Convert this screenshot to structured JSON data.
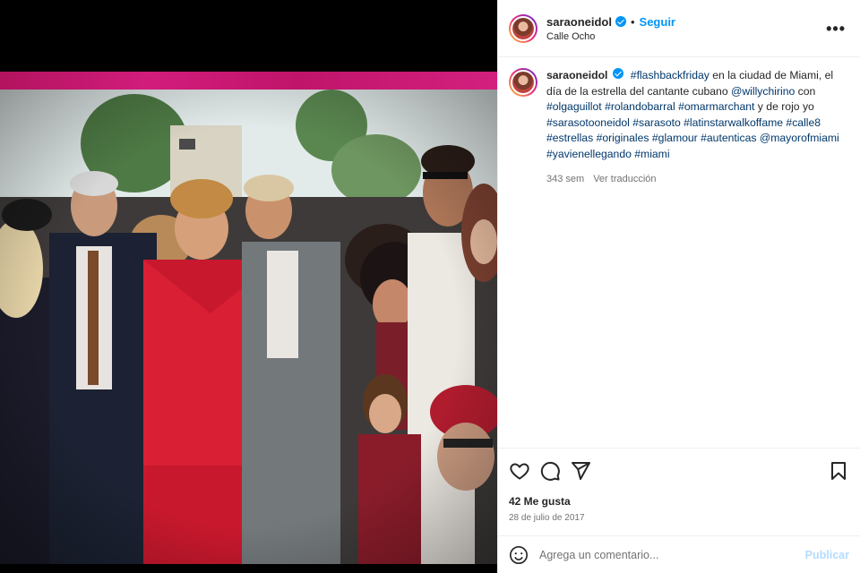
{
  "post": {
    "username": "saraoneidol",
    "follow_label": "Seguir",
    "dot": "•",
    "location": "Calle Ocho",
    "more_label": "•••",
    "caption": {
      "username": "saraoneidol",
      "segments": [
        {
          "t": "#flashbackfriday",
          "tag": true
        },
        {
          "t": " en la ciudad de Miami, el día de la estrella del cantante cubano ",
          "tag": false
        },
        {
          "t": "@willychirino",
          "tag": true
        },
        {
          "t": " con ",
          "tag": false
        },
        {
          "t": "#olgaguillot",
          "tag": true
        },
        {
          "t": " ",
          "tag": false
        },
        {
          "t": "#rolandobarral",
          "tag": true
        },
        {
          "t": " ",
          "tag": false
        },
        {
          "t": "#omarmarchant",
          "tag": true
        },
        {
          "t": " y de rojo yo ",
          "tag": false
        },
        {
          "t": "#sarasotooneidol",
          "tag": true
        },
        {
          "t": " ",
          "tag": false
        },
        {
          "t": "#sarasoto",
          "tag": true
        },
        {
          "t": " ",
          "tag": false
        },
        {
          "t": "#latinstarwalkoffame",
          "tag": true
        },
        {
          "t": " ",
          "tag": false
        },
        {
          "t": "#calle8",
          "tag": true
        },
        {
          "t": " ",
          "tag": false
        },
        {
          "t": "#estrellas",
          "tag": true
        },
        {
          "t": " ",
          "tag": false
        },
        {
          "t": "#originales",
          "tag": true
        },
        {
          "t": " ",
          "tag": false
        },
        {
          "t": "#glamour",
          "tag": true
        },
        {
          "t": " ",
          "tag": false
        },
        {
          "t": "#autenticas",
          "tag": true
        },
        {
          "t": " ",
          "tag": false
        },
        {
          "t": "@mayorofmiami",
          "tag": true
        },
        {
          "t": " ",
          "tag": false
        },
        {
          "t": "#yavienellegando",
          "tag": true
        },
        {
          "t": " ",
          "tag": false
        },
        {
          "t": "#miami",
          "tag": true
        }
      ]
    },
    "age": "343 sem",
    "translate_label": "Ver traducción",
    "likes": "42 Me gusta",
    "date": "28 de julio de 2017",
    "comment_placeholder": "Agrega un comentario...",
    "publish_label": "Publicar"
  },
  "icons": {
    "like": "heart-icon",
    "comment": "comment-icon",
    "share": "send-icon",
    "save": "bookmark-icon",
    "emoji": "emoji-icon",
    "verified": "verified-badge-icon"
  },
  "colors": {
    "accent": "#0095f6",
    "tag": "#00376b",
    "publish_disabled": "#b3dbff",
    "photo_border": "#c0156e"
  }
}
